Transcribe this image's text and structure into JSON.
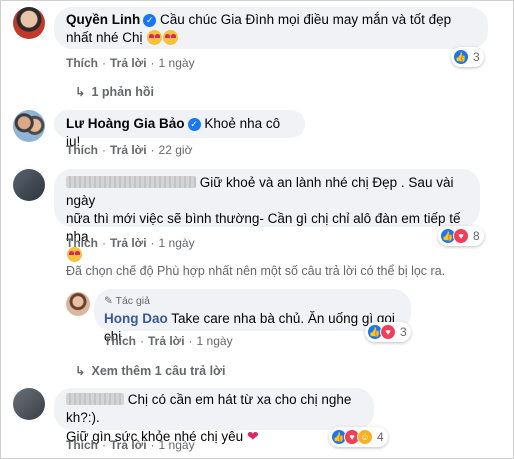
{
  "comments": [
    {
      "author": "Quyền Linh",
      "text": "Cầu chúc Gia Đình mọi điều may mắn và tốt đẹp nhất nhé Chị",
      "actions": {
        "like": "Thích",
        "reply": "Trả lời",
        "time": "1 ngày"
      },
      "reaction_count": "3",
      "replies_link": "1 phản hồi"
    },
    {
      "author": "Lư Hoàng Gia Bảo",
      "text": "Khoẻ nha cô iu!",
      "actions": {
        "like": "Thích",
        "reply": "Trả lời",
        "time": "22 giờ"
      }
    },
    {
      "author": "",
      "text_line1": "Giữ khoẻ và an lành nhé chị Đẹp . Sau vài ngày",
      "text_line2": "nữa thì mới việc sẽ bình thường- Cần gì chị chỉ alô đàn em tiếp tế nha",
      "actions": {
        "like": "Thích",
        "reply": "Trả lời",
        "time": "1 ngày"
      },
      "reaction_count": "8"
    },
    {
      "author": "",
      "text_line1": "Chị có cần em hát từ xa cho chị nghe kh?:).",
      "text_line2": "Giữ gìn sức khỏe nhé chị yêu",
      "actions": {
        "like": "Thích",
        "reply": "Trả lời",
        "time": "1 ngày"
      },
      "reaction_count": "4"
    }
  ],
  "filter_notice": "Đã chọn chế độ Phù hợp nhất nên một số câu trả lời có thể bị lọc ra.",
  "reply": {
    "badge": "Tác giả",
    "author": "Hong Dao",
    "text": "Take care nha bà chủ. Ăn uống gì gọi chị",
    "actions": {
      "like": "Thích",
      "reply": "Trả lời",
      "time": "1 ngày"
    },
    "reaction_count": "3"
  },
  "more_replies": "Xem thêm 1 câu trả lời",
  "icons": [
    "verified-icon",
    "reply-arrow-icon",
    "like-reaction-icon",
    "love-reaction-icon",
    "haha-reaction-icon"
  ],
  "colors": {
    "accent": "#1877f2",
    "bubble": "#f0f2f5",
    "secondary_text": "#65676b",
    "love": "#f33e58"
  }
}
